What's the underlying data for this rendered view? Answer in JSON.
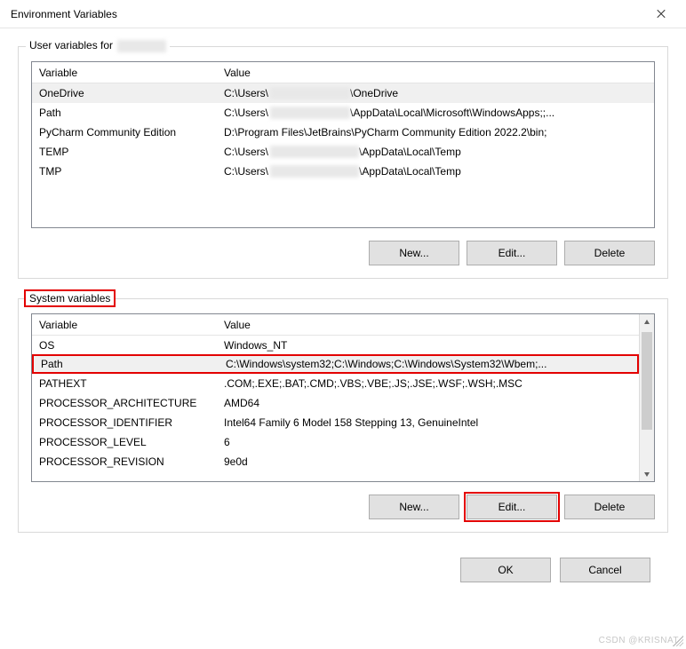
{
  "title": "Environment Variables",
  "userSection": {
    "label": "User variables for",
    "headers": {
      "variable": "Variable",
      "value": "Value"
    },
    "rows": [
      {
        "variable": "OneDrive",
        "value_pre": "C:\\Users\\",
        "value_post": "\\OneDrive"
      },
      {
        "variable": "Path",
        "value_pre": "C:\\Users\\",
        "value_post": "\\AppData\\Local\\Microsoft\\WindowsApps;;..."
      },
      {
        "variable": "PyCharm Community Edition",
        "value_full": "D:\\Program Files\\JetBrains\\PyCharm Community Edition 2022.2\\bin;"
      },
      {
        "variable": "TEMP",
        "value_pre": "C:\\Users\\",
        "value_post": "\\AppData\\Local\\Temp"
      },
      {
        "variable": "TMP",
        "value_pre": "C:\\Users\\",
        "value_post": "\\AppData\\Local\\Temp"
      }
    ],
    "buttons": {
      "new": "New...",
      "edit": "Edit...",
      "delete": "Delete"
    }
  },
  "systemSection": {
    "label": "System variables",
    "headers": {
      "variable": "Variable",
      "value": "Value"
    },
    "rows": [
      {
        "variable": "OS",
        "value": "Windows_NT"
      },
      {
        "variable": "Path",
        "value": "C:\\Windows\\system32;C:\\Windows;C:\\Windows\\System32\\Wbem;..."
      },
      {
        "variable": "PATHEXT",
        "value": ".COM;.EXE;.BAT;.CMD;.VBS;.VBE;.JS;.JSE;.WSF;.WSH;.MSC"
      },
      {
        "variable": "PROCESSOR_ARCHITECTURE",
        "value": "AMD64"
      },
      {
        "variable": "PROCESSOR_IDENTIFIER",
        "value": "Intel64 Family 6 Model 158 Stepping 13, GenuineIntel"
      },
      {
        "variable": "PROCESSOR_LEVEL",
        "value": "6"
      },
      {
        "variable": "PROCESSOR_REVISION",
        "value": "9e0d"
      }
    ],
    "buttons": {
      "new": "New...",
      "edit": "Edit...",
      "delete": "Delete"
    }
  },
  "dialogButtons": {
    "ok": "OK",
    "cancel": "Cancel"
  },
  "watermark": "CSDN @KRISNAT"
}
